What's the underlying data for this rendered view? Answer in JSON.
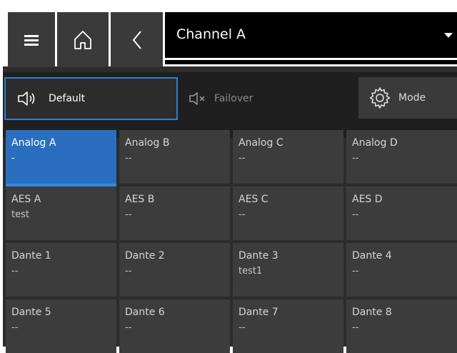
{
  "header": {
    "channel_title": "Channel A"
  },
  "modes": {
    "default_label": "Default",
    "failover_label": "Failover",
    "mode_label": "Mode"
  },
  "inputs": [
    {
      "name": "Analog A",
      "value": "-"
    },
    {
      "name": "Analog B",
      "value": "--"
    },
    {
      "name": "Analog C",
      "value": "--"
    },
    {
      "name": "Analog D",
      "value": "--"
    },
    {
      "name": "AES A",
      "value": "test"
    },
    {
      "name": "AES B",
      "value": "--"
    },
    {
      "name": "AES C",
      "value": "--"
    },
    {
      "name": "AES D",
      "value": "--"
    },
    {
      "name": "Dante 1",
      "value": "--"
    },
    {
      "name": "Dante 2",
      "value": "--"
    },
    {
      "name": "Dante 3",
      "value": "test1"
    },
    {
      "name": "Dante 4",
      "value": "--"
    },
    {
      "name": "Dante 5",
      "value": "--"
    },
    {
      "name": "Dante 6",
      "value": "--"
    },
    {
      "name": "Dante 7",
      "value": "--"
    },
    {
      "name": "Dante 8",
      "value": "--"
    }
  ],
  "colors": {
    "accent": "#2f7fd0",
    "panel": "#3a3a3a",
    "background": "#2c2c2c"
  },
  "icons": {
    "menu": "hamburger-icon",
    "home": "home-icon",
    "back": "chevron-left-icon",
    "speaker": "speaker-icon",
    "mute": "speaker-muted-icon",
    "mode": "gear-icon"
  }
}
